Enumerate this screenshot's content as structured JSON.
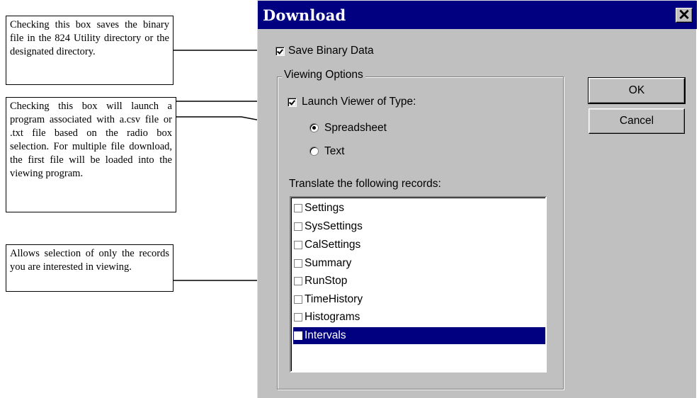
{
  "callouts": [
    "Checking this box saves the binary file in the 824 Utility directory or the designated directory.",
    "Checking this box will launch a program associated with a.csv file or .txt file based on the radio box selection. For multiple file download, the first file will be loaded into the viewing program.",
    "Allows selection of only the records you are interested in viewing."
  ],
  "dialog": {
    "title": "Download",
    "close_glyph": "✕",
    "save_binary": {
      "label": "Save Binary Data",
      "checked": true
    },
    "viewing_options": {
      "group_label": "Viewing Options",
      "launch_viewer": {
        "label": "Launch Viewer of Type:",
        "checked": true
      },
      "radio_options": [
        {
          "label": "Spreadsheet",
          "selected": true
        },
        {
          "label": "Text",
          "selected": false
        }
      ],
      "translate_label": "Translate the following records:",
      "records": [
        {
          "label": "Settings",
          "selected": false
        },
        {
          "label": "SysSettings",
          "selected": false
        },
        {
          "label": "CalSettings",
          "selected": false
        },
        {
          "label": "Summary",
          "selected": false
        },
        {
          "label": "RunStop",
          "selected": false
        },
        {
          "label": "TimeHistory",
          "selected": false
        },
        {
          "label": "Histograms",
          "selected": false
        },
        {
          "label": "Intervals",
          "selected": true
        }
      ]
    },
    "buttons": {
      "ok": "OK",
      "cancel": "Cancel"
    }
  }
}
